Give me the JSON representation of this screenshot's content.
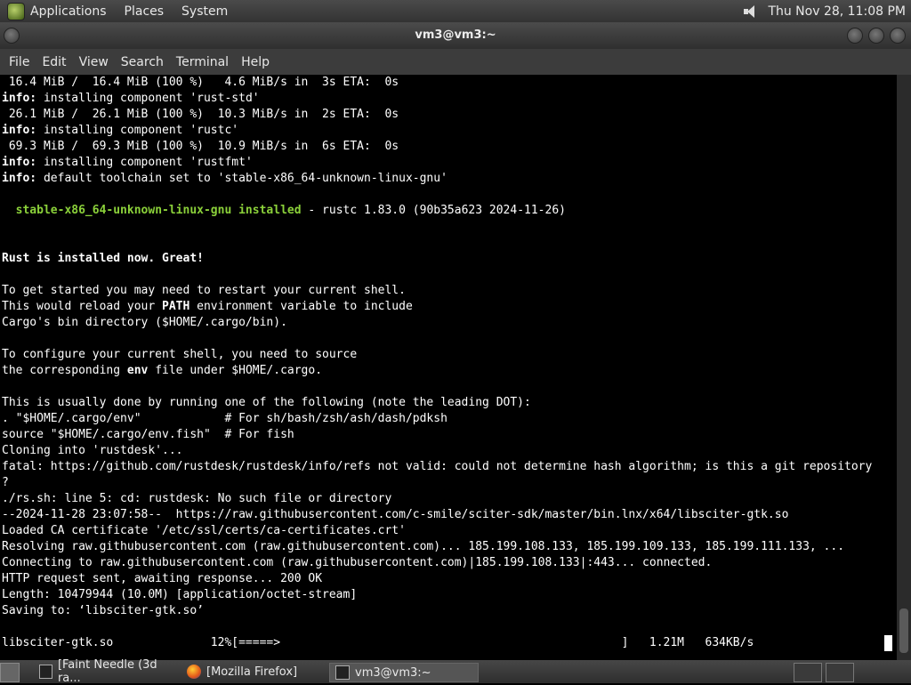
{
  "top_panel": {
    "menus": [
      "Applications",
      "Places",
      "System"
    ],
    "clock": "Thu Nov 28, 11:08 PM"
  },
  "window": {
    "title": "vm3@vm3:~",
    "menu": [
      "File",
      "Edit",
      "View",
      "Search",
      "Terminal",
      "Help"
    ]
  },
  "terminal": {
    "lines": [
      [
        {
          "t": " 16.4 MiB /  16.4 MiB (100 %)   4.6 MiB/s in  3s ETA:  0s"
        }
      ],
      [
        {
          "t": "info:",
          "s": "b"
        },
        {
          "t": " installing component 'rust-std'"
        }
      ],
      [
        {
          "t": " 26.1 MiB /  26.1 MiB (100 %)  10.3 MiB/s in  2s ETA:  0s"
        }
      ],
      [
        {
          "t": "info:",
          "s": "b"
        },
        {
          "t": " installing component 'rustc'"
        }
      ],
      [
        {
          "t": " 69.3 MiB /  69.3 MiB (100 %)  10.9 MiB/s in  6s ETA:  0s"
        }
      ],
      [
        {
          "t": "info:",
          "s": "b"
        },
        {
          "t": " installing component 'rustfmt'"
        }
      ],
      [
        {
          "t": "info:",
          "s": "b"
        },
        {
          "t": " default toolchain set to 'stable-x86_64-unknown-linux-gnu'"
        }
      ],
      [],
      [
        {
          "t": "  "
        },
        {
          "t": "stable-x86_64-unknown-linux-gnu installed",
          "s": "g"
        },
        {
          "t": " - rustc 1.83.0 (90b35a623 2024-11-26)"
        }
      ],
      [],
      [],
      [
        {
          "t": "Rust is installed now. Great!",
          "s": "b"
        }
      ],
      [],
      [
        {
          "t": "To get started you may need to restart your current shell."
        }
      ],
      [
        {
          "t": "This would reload your "
        },
        {
          "t": "PATH",
          "s": "b"
        },
        {
          "t": " environment variable to include"
        }
      ],
      [
        {
          "t": "Cargo's bin directory ($HOME/.cargo/bin)."
        }
      ],
      [],
      [
        {
          "t": "To configure your current shell, you need to source"
        }
      ],
      [
        {
          "t": "the corresponding "
        },
        {
          "t": "env",
          "s": "b"
        },
        {
          "t": " file under $HOME/.cargo."
        }
      ],
      [],
      [
        {
          "t": "This is usually done by running one of the following (note the leading DOT):"
        }
      ],
      [
        {
          "t": ". \"$HOME/.cargo/env\"            # For sh/bash/zsh/ash/dash/pdksh"
        }
      ],
      [
        {
          "t": "source \"$HOME/.cargo/env.fish\"  # For fish"
        }
      ],
      [
        {
          "t": "Cloning into 'rustdesk'..."
        }
      ],
      [
        {
          "t": "fatal: https://github.com/rustdesk/rustdesk/info/refs not valid: could not determine hash algorithm; is this a git repository"
        }
      ],
      [
        {
          "t": "?"
        }
      ],
      [
        {
          "t": "./rs.sh: line 5: cd: rustdesk: No such file or directory"
        }
      ],
      [
        {
          "t": "--2024-11-28 23:07:58--  https://raw.githubusercontent.com/c-smile/sciter-sdk/master/bin.lnx/x64/libsciter-gtk.so"
        }
      ],
      [
        {
          "t": "Loaded CA certificate '/etc/ssl/certs/ca-certificates.crt'"
        }
      ],
      [
        {
          "t": "Resolving raw.githubusercontent.com (raw.githubusercontent.com)... 185.199.108.133, 185.199.109.133, 185.199.111.133, ..."
        }
      ],
      [
        {
          "t": "Connecting to raw.githubusercontent.com (raw.githubusercontent.com)|185.199.108.133|:443... connected."
        }
      ],
      [
        {
          "t": "HTTP request sent, awaiting response... 200 OK"
        }
      ],
      [
        {
          "t": "Length: 10479944 (10.0M) [application/octet-stream]"
        }
      ],
      [
        {
          "t": "Saving to: ‘libsciter-gtk.so’"
        }
      ],
      [],
      [
        {
          "t": "libsciter-gtk.so              12%[=====>                                                 ]   1.21M   634KB/s"
        }
      ]
    ]
  },
  "taskbar": {
    "tasks": [
      "[Faint Needle (3d ra...",
      "[Mozilla Firefox]",
      "vm3@vm3:~"
    ]
  },
  "icons": [
    "app-menu-icon",
    "volume-icon",
    "show-desktop-icon",
    "firefox-icon",
    "terminal-icon",
    "workspace-switcher-icon"
  ]
}
